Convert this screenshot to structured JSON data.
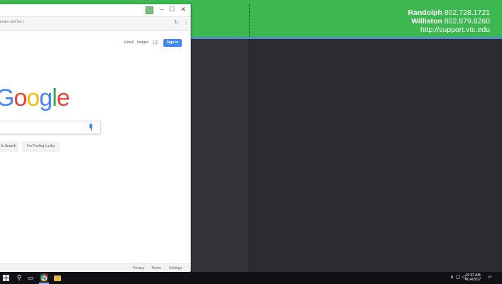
{
  "banner": {
    "line1_name": "Randolph",
    "line1_phone": "802.728.1721",
    "line2_name": "Williston",
    "line2_phone": "802.879.8260",
    "line3": "http://support.vtc.edu"
  },
  "browser": {
    "address_text": "ender and Go )",
    "nav": {
      "gmail": "Gmail",
      "images": "Images",
      "signin": "Sign in"
    },
    "logo_text": [
      "G",
      "o",
      "o",
      "g",
      "l",
      "e"
    ],
    "buttons": {
      "search": "le Search",
      "lucky": "I'm Feeling Lucky"
    },
    "footer": {
      "privacy": "Privacy",
      "terms": "Terms",
      "settings": "Settings"
    }
  },
  "taskbar": {
    "clock_time": "10:32 AM",
    "clock_date": "4/14/2017"
  },
  "colors": {
    "banner_green": "#3db74f",
    "banner_line": "#4a90c9",
    "desktop": "#2b2c30",
    "signin_blue": "#4285f4"
  }
}
